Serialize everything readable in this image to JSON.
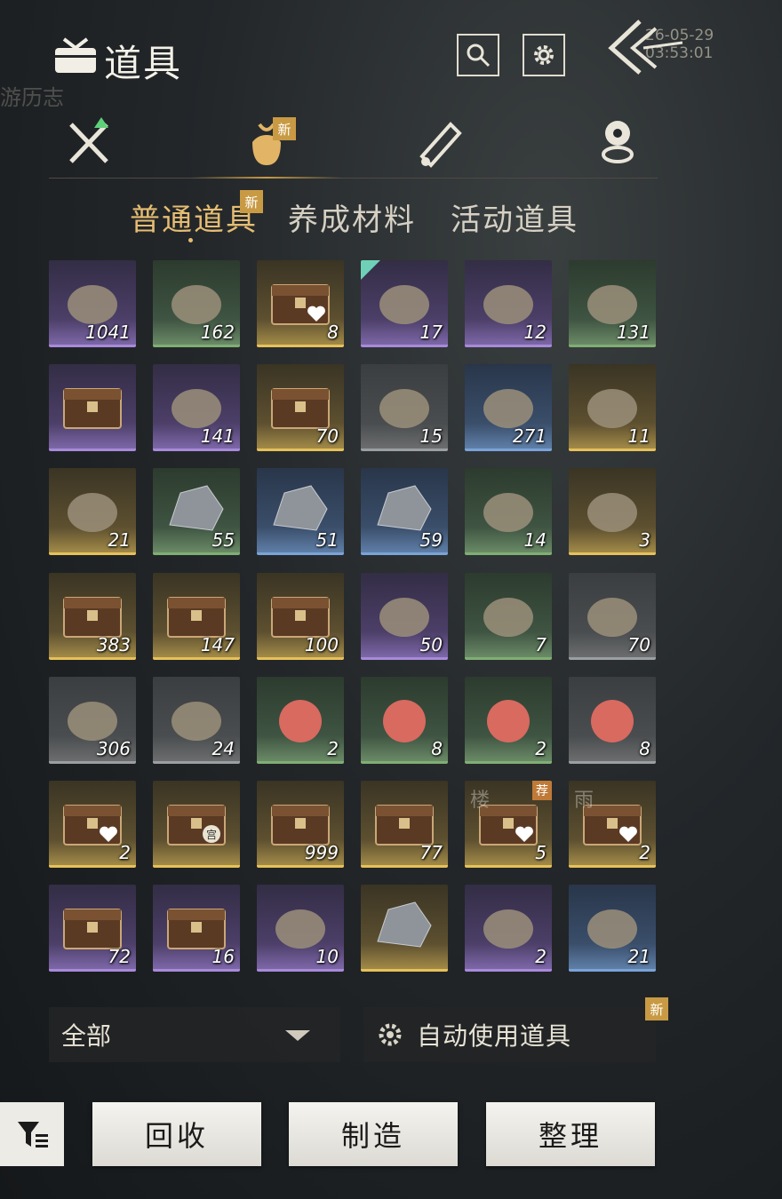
{
  "header": {
    "title": "道具",
    "timestamp": "26-05-29 03:53:01",
    "background_faded_labels": [
      "游历志"
    ]
  },
  "category_tabs": [
    {
      "id": "equipment",
      "icon": "crossed-swords-icon",
      "has_up_arrow": true,
      "active": false
    },
    {
      "id": "items",
      "icon": "bag-icon",
      "badge": "新",
      "active": true
    },
    {
      "id": "scroll",
      "icon": "scroll-icon",
      "active": false
    },
    {
      "id": "pin",
      "icon": "location-pin-icon",
      "active": false
    }
  ],
  "sub_tabs": [
    {
      "label": "普通道具",
      "active": true,
      "badge": "新"
    },
    {
      "label": "养成材料",
      "active": false
    },
    {
      "label": "活动道具",
      "active": false
    }
  ],
  "items": [
    {
      "icon": "gold-flower-card-icon",
      "count": "1041",
      "rarity": "purple"
    },
    {
      "icon": "rice-bowl-icon",
      "count": "162",
      "rarity": "green"
    },
    {
      "icon": "chest-heart-icon",
      "count": "8",
      "rarity": "gold",
      "overlay": "heart"
    },
    {
      "icon": "soup-bowl-icon",
      "count": "17",
      "rarity": "purple",
      "corner": "teal"
    },
    {
      "icon": "orb-stand-icon",
      "count": "12",
      "rarity": "purple"
    },
    {
      "icon": "plum-blossom-icon",
      "count": "131",
      "rarity": "green"
    },
    {
      "icon": "wooden-cabinet-icon",
      "count": "",
      "rarity": "purple"
    },
    {
      "icon": "bird-medallion-icon",
      "count": "141",
      "rarity": "purple"
    },
    {
      "icon": "chest-icon",
      "count": "70",
      "rarity": "gold"
    },
    {
      "icon": "arrows-icon",
      "count": "15",
      "rarity": "gray"
    },
    {
      "icon": "dye-box-icon",
      "count": "271",
      "rarity": "blue"
    },
    {
      "icon": "bronze-bell-icon",
      "count": "11",
      "rarity": "gold"
    },
    {
      "icon": "wind-spirit-icon",
      "count": "21",
      "rarity": "gold"
    },
    {
      "icon": "gold-ore-icon",
      "count": "55",
      "rarity": "green"
    },
    {
      "icon": "cracked-stone-icon",
      "count": "51",
      "rarity": "blue"
    },
    {
      "icon": "jade-ore-icon",
      "count": "59",
      "rarity": "blue"
    },
    {
      "icon": "fur-pelt-icon",
      "count": "14",
      "rarity": "green"
    },
    {
      "icon": "ghost-spirit-icon",
      "count": "3",
      "rarity": "gold"
    },
    {
      "icon": "chest-ore-icon",
      "count": "383",
      "rarity": "gold"
    },
    {
      "icon": "chest-leaf-icon",
      "count": "147",
      "rarity": "gold"
    },
    {
      "icon": "chest-shell-icon",
      "count": "100",
      "rarity": "gold"
    },
    {
      "icon": "cushion-box-icon",
      "count": "50",
      "rarity": "purple"
    },
    {
      "icon": "radish-icon",
      "count": "7",
      "rarity": "green"
    },
    {
      "icon": "wine-jar-icon",
      "count": "70",
      "rarity": "gray"
    },
    {
      "icon": "grain-sack-icon",
      "count": "306",
      "rarity": "gray"
    },
    {
      "icon": "fish-icon",
      "count": "24",
      "rarity": "gray"
    },
    {
      "icon": "dates-icon",
      "count": "2",
      "rarity": "green"
    },
    {
      "icon": "peach-leaf-icon",
      "count": "8",
      "rarity": "green"
    },
    {
      "icon": "taro-icon",
      "count": "2",
      "rarity": "green"
    },
    {
      "icon": "peach-icon",
      "count": "8",
      "rarity": "gray"
    },
    {
      "icon": "chest-heart-icon",
      "count": "2",
      "rarity": "gold",
      "overlay": "heart"
    },
    {
      "icon": "chest-seal-icon",
      "count": "",
      "rarity": "gold",
      "overlay": "seal",
      "seal_text": "宫"
    },
    {
      "icon": "chest-ore-icon",
      "count": "999",
      "rarity": "gold"
    },
    {
      "icon": "chest-robe-icon",
      "count": "77",
      "rarity": "gold"
    },
    {
      "icon": "chest-heart-icon",
      "count": "5",
      "rarity": "gold",
      "overlay": "heart",
      "rec_badge": "荐",
      "faint_char": "楼"
    },
    {
      "icon": "chest-heart-icon",
      "count": "2",
      "rarity": "gold",
      "overlay": "heart",
      "faint_char": "雨"
    },
    {
      "icon": "carved-box-icon",
      "count": "72",
      "rarity": "purple"
    },
    {
      "icon": "iron-chest-icon",
      "count": "16",
      "rarity": "purple"
    },
    {
      "icon": "mountain-token-icon",
      "count": "10",
      "rarity": "purple"
    },
    {
      "icon": "purple-crystal-icon",
      "count": "",
      "rarity": "gold"
    },
    {
      "icon": "fabric-box-icon",
      "count": "2",
      "rarity": "purple"
    },
    {
      "icon": "painting-scroll-icon",
      "count": "21",
      "rarity": "blue"
    }
  ],
  "filter": {
    "selected": "全部"
  },
  "auto_use": {
    "label": "自动使用道具",
    "badge": "新"
  },
  "actions": {
    "recycle": "回收",
    "craft": "制造",
    "sort": "整理"
  },
  "colors": {
    "accent_gold": "#e6bd72",
    "badge_gold": "#c99a44"
  }
}
